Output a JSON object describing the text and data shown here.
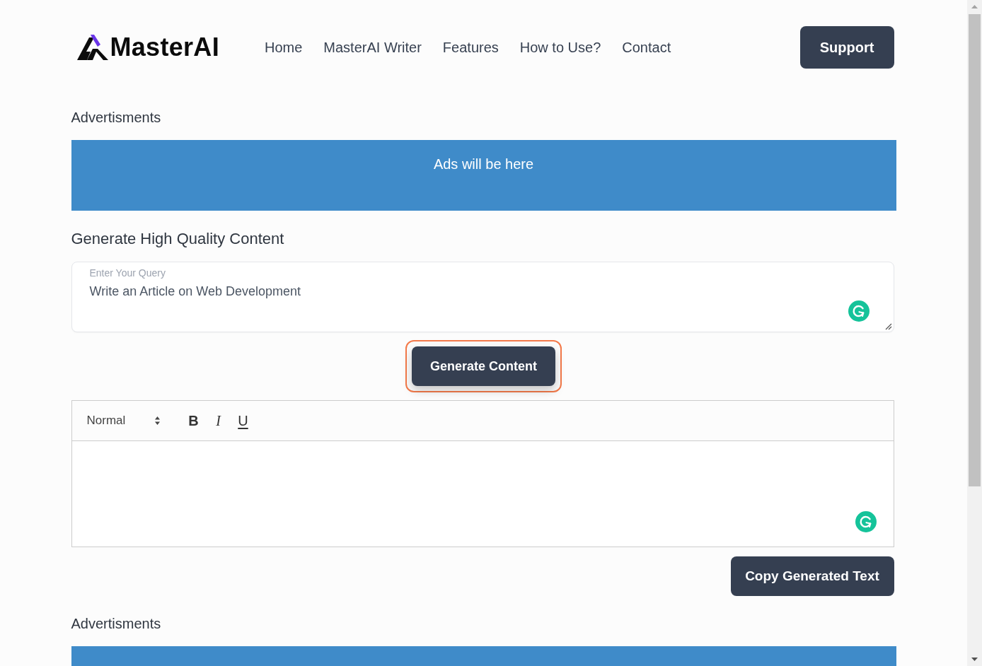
{
  "header": {
    "logo": "MasterAI",
    "nav": [
      "Home",
      "MasterAI Writer",
      "Features",
      "How to Use?",
      "Contact"
    ],
    "support_button": "Support"
  },
  "top_ads": {
    "heading": "Advertisments",
    "banner": "Ads will be here"
  },
  "generator": {
    "heading": "Generate High Quality Content",
    "query": {
      "label": "Enter Your Query",
      "value": "Write an Article on Web Development"
    },
    "generate_button": {
      "label": "Generate Content",
      "focused": true
    }
  },
  "editor": {
    "format": "Normal",
    "tools": [
      {
        "kind": "bold",
        "label": "B"
      },
      {
        "kind": "italic",
        "label": "I"
      },
      {
        "kind": "underline",
        "label": "U"
      }
    ],
    "copy_button": "Copy Generated Text"
  },
  "bottom_ads": {
    "heading": "Advertisments"
  }
}
